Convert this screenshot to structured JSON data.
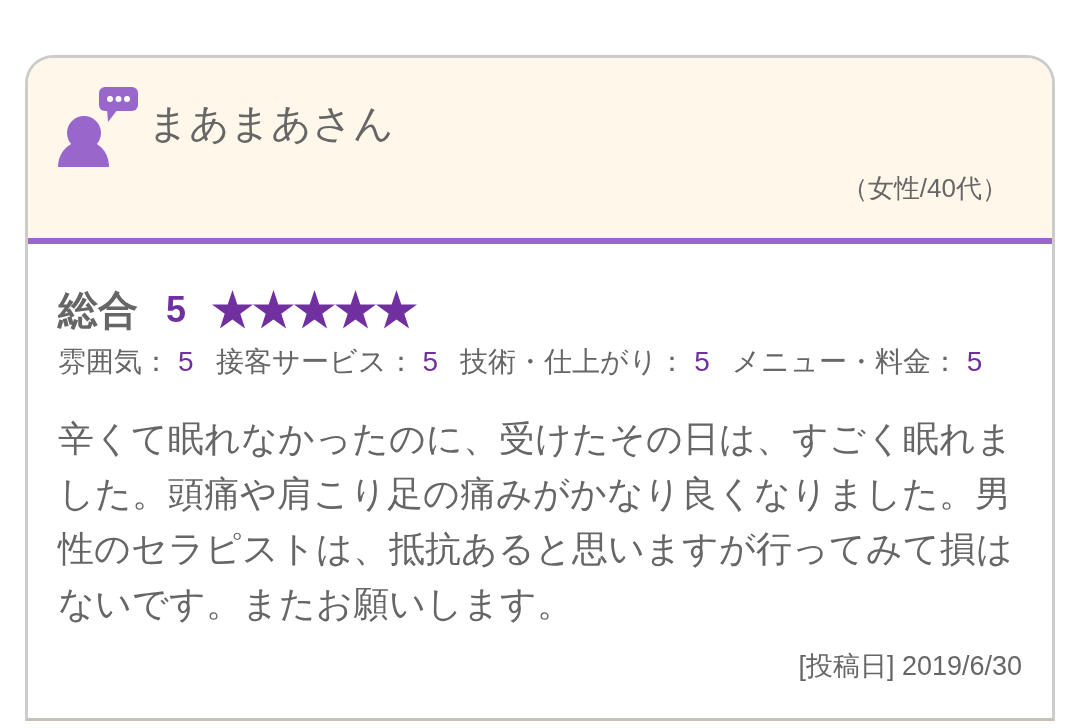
{
  "reviewer": {
    "name": "まあまあさん",
    "demographic": "（女性/40代）"
  },
  "overall": {
    "label": "総合",
    "score": "5",
    "stars": 5
  },
  "sub_ratings": [
    {
      "label": "雰囲気：",
      "value": "5"
    },
    {
      "label": "接客サービス：",
      "value": "5"
    },
    {
      "label": "技術・仕上がり：",
      "value": "5"
    },
    {
      "label": "メニュー・料金：",
      "value": "5"
    }
  ],
  "comment": "辛くて眠れなかったのに、受けたその日は、すごく眠れました。頭痛や肩こり足の痛みがかなり良くなりました。男性のセラピストは、抵抗あると思いますが行ってみて損はないです。またお願いします。",
  "posted": "[投稿日] 2019/6/30"
}
